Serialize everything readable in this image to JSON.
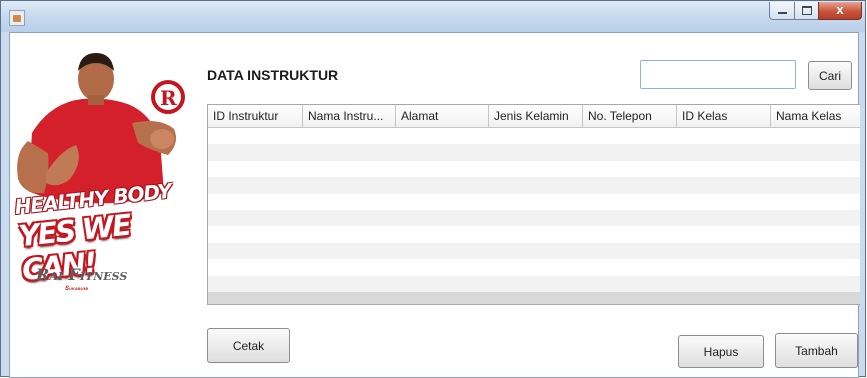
{
  "window": {
    "title": "",
    "controls": {
      "minimize_icon": "minimize-icon",
      "maximize_icon": "maximize-icon",
      "close_icon": "close-icon",
      "close_glyph": "x"
    }
  },
  "branding": {
    "logo_letter": "R",
    "slogan_line1": "HEALTHY BODY",
    "slogan_line2": "YES WE CAN!",
    "name": "Rai Fitness",
    "city": "Sukabumi",
    "accent_color": "#c3161f"
  },
  "page": {
    "title": "DATA INSTRUKTUR"
  },
  "search": {
    "value": "",
    "placeholder": "",
    "button_label": "Cari"
  },
  "table": {
    "columns": [
      "ID Instruktur",
      "Nama Instru...",
      "Alamat",
      "Jenis Kelamin",
      "No. Telepon",
      "ID Kelas",
      "Nama Kelas"
    ],
    "rows": []
  },
  "actions": {
    "print_label": "Cetak",
    "delete_label": "Hapus",
    "add_label": "Tambah"
  }
}
